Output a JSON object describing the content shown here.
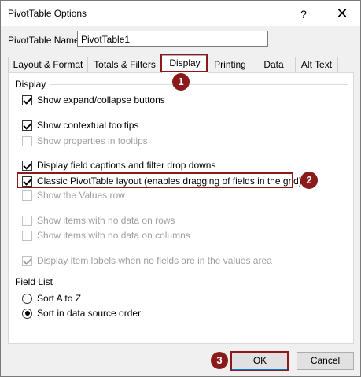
{
  "window": {
    "title": "PivotTable Options",
    "help_glyph": "?",
    "close_glyph": "✕"
  },
  "name_field": {
    "label": "PivotTable Name:",
    "value": "PivotTable1"
  },
  "tabs": [
    {
      "label": "Layout & Format",
      "active": false
    },
    {
      "label": "Totals & Filters",
      "active": false
    },
    {
      "label": "Display",
      "active": true
    },
    {
      "label": "Printing",
      "active": false
    },
    {
      "label": "Data",
      "active": false
    },
    {
      "label": "Alt Text",
      "active": false
    }
  ],
  "display_group": {
    "title": "Display",
    "options": [
      {
        "label": "Show expand/collapse buttons",
        "checked": true,
        "enabled": true
      },
      {
        "label": "Show contextual tooltips",
        "checked": true,
        "enabled": true
      },
      {
        "label": "Show properties in tooltips",
        "checked": false,
        "enabled": false
      },
      {
        "label": "Display field captions and filter drop downs",
        "checked": true,
        "enabled": true
      },
      {
        "label": "Classic PivotTable layout (enables dragging of fields in the grid)",
        "checked": true,
        "enabled": true
      },
      {
        "label": "Show the Values row",
        "checked": false,
        "enabled": false
      },
      {
        "label": "Show items with no data on rows",
        "checked": false,
        "enabled": false
      },
      {
        "label": "Show items with no data on columns",
        "checked": false,
        "enabled": false
      },
      {
        "label": "Display item labels when no fields are in the values area",
        "checked": true,
        "enabled": false
      }
    ]
  },
  "field_list_group": {
    "title": "Field List",
    "options": [
      {
        "label": "Sort A to Z",
        "selected": false
      },
      {
        "label": "Sort in data source order",
        "selected": true
      }
    ]
  },
  "buttons": {
    "ok": "OK",
    "cancel": "Cancel"
  },
  "annotations": {
    "step1": "1",
    "step2": "2",
    "step3": "3",
    "color": "#8b1a1a"
  }
}
